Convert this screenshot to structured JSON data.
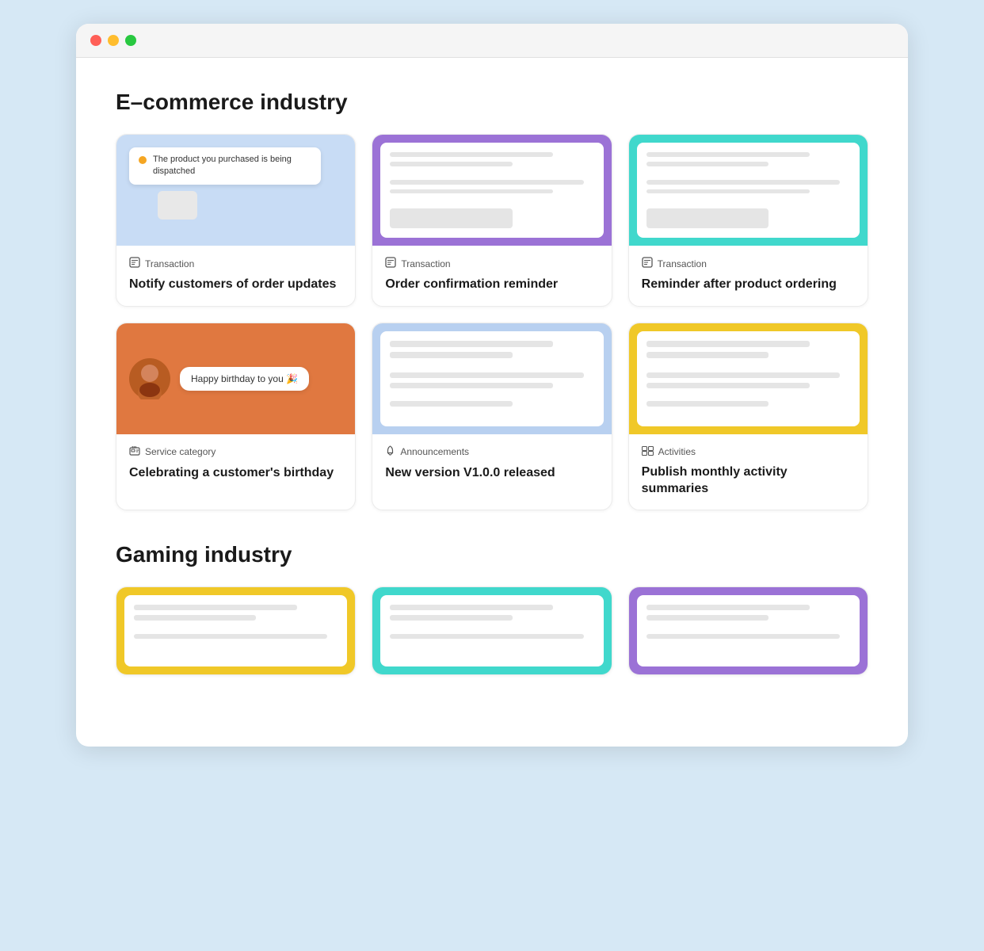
{
  "ecommerce_section": {
    "title": "E–commerce industry",
    "cards": [
      {
        "id": "card-dispatch",
        "preview_type": "blue-notification",
        "notification_text": "The product you purchased is being dispatched",
        "category_icon": "transaction-icon",
        "category_label": "Transaction",
        "title": "Notify customers of order updates"
      },
      {
        "id": "card-order-confirm",
        "preview_type": "purple-bordered",
        "category_icon": "transaction-icon",
        "category_label": "Transaction",
        "title": "Order confirmation reminder"
      },
      {
        "id": "card-reminder",
        "preview_type": "teal-bordered",
        "category_icon": "transaction-icon",
        "category_label": "Transaction",
        "title": "Reminder after product ordering"
      },
      {
        "id": "card-birthday",
        "preview_type": "orange-birthday",
        "birthday_text": "Happy birthday to you 🎉",
        "category_icon": "service-icon",
        "category_label": "Service category",
        "title": "Celebrating a customer's birthday"
      },
      {
        "id": "card-announcement",
        "preview_type": "lightblue-bordered",
        "category_icon": "bell-icon",
        "category_label": "Announcements",
        "title": "New version V1.0.0 released"
      },
      {
        "id": "card-activities",
        "preview_type": "yellow-bordered",
        "category_icon": "activities-icon",
        "category_label": "Activities",
        "title": "Publish monthly activity summaries"
      }
    ]
  },
  "gaming_section": {
    "title": "Gaming industry",
    "cards": [
      {
        "id": "gaming-1",
        "preview_type": "yellow-bordered"
      },
      {
        "id": "gaming-2",
        "preview_type": "teal-bordered"
      },
      {
        "id": "gaming-3",
        "preview_type": "purple-bordered"
      }
    ]
  }
}
